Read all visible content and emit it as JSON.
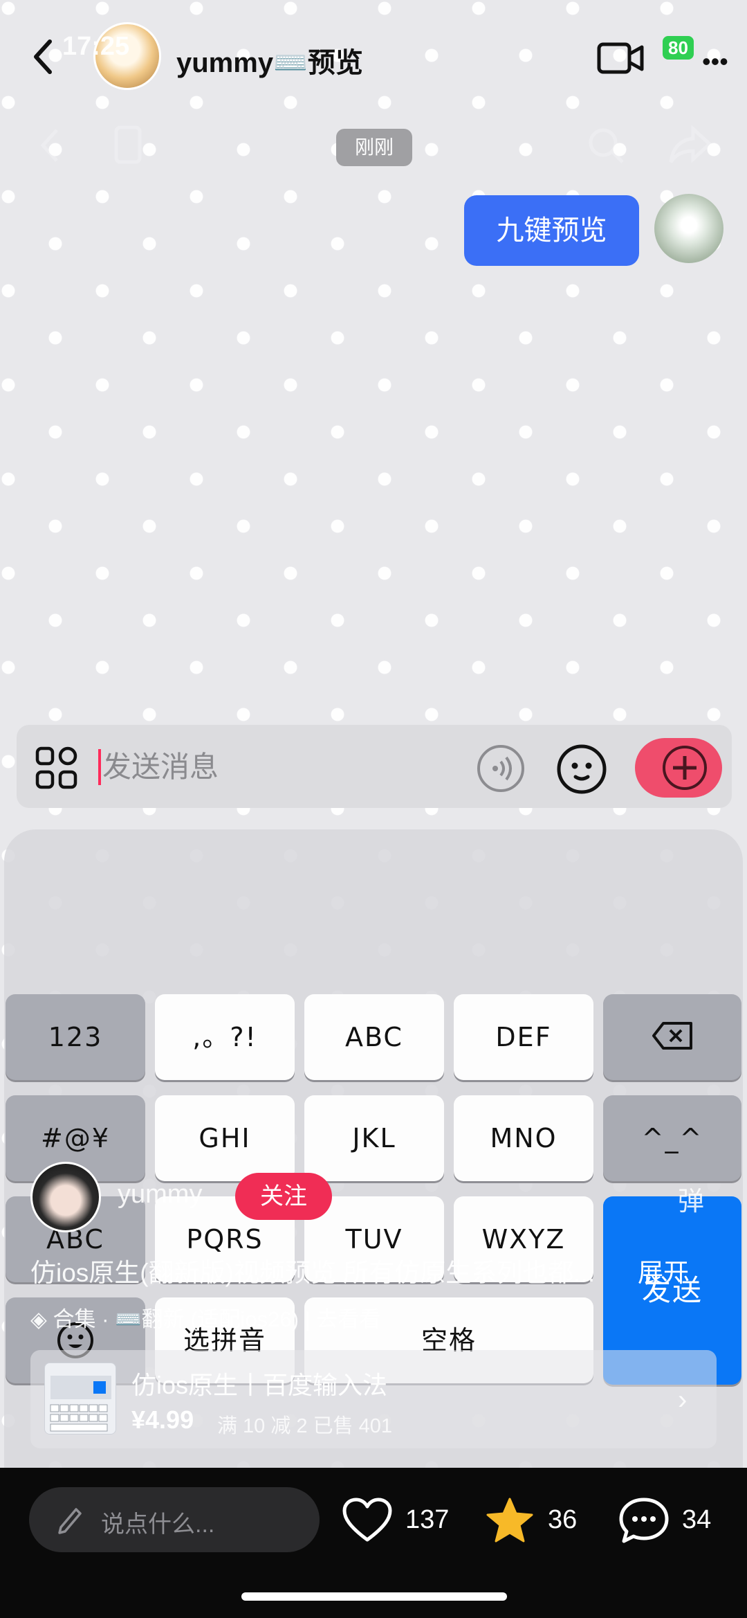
{
  "status": {
    "time": "17:25",
    "battery": "80"
  },
  "header": {
    "title": "yummy⌨️预览"
  },
  "chat": {
    "timestamp": "刚刚",
    "message": "九键预览"
  },
  "input": {
    "placeholder": "发送消息"
  },
  "keyboard": {
    "row1": [
      "123",
      ",。?!",
      "ABC",
      "DEF"
    ],
    "row2": [
      "#@¥",
      "GHI",
      "JKL",
      "MNO",
      "^_^"
    ],
    "row3": [
      "ABC",
      "PQRS",
      "TUV",
      "WXYZ"
    ],
    "row4": [
      "选拼音",
      "空格"
    ],
    "send": "发送"
  },
  "video": {
    "author": "yummy",
    "follow": "关注",
    "danmu": "弹",
    "description": "仿ios原生(翻新版)视频预览 所有仿原生系列也都...",
    "expand": "展开",
    "collection": "合集 · ⌨️翻新 (适配ios26) | 去看看",
    "product": {
      "title": "仿ios原生丨百度输入法",
      "price": "¥4.99",
      "meta": "满 10 减 2  已售 401"
    }
  },
  "bottom": {
    "placeholder": "说点什么...",
    "likes": "137",
    "favorites": "36",
    "comments": "34"
  },
  "colors": {
    "accent_blue": "#3b6ff6",
    "send_blue": "#0a77f6",
    "follow_red": "#f02d55",
    "star": "#f7b928"
  }
}
